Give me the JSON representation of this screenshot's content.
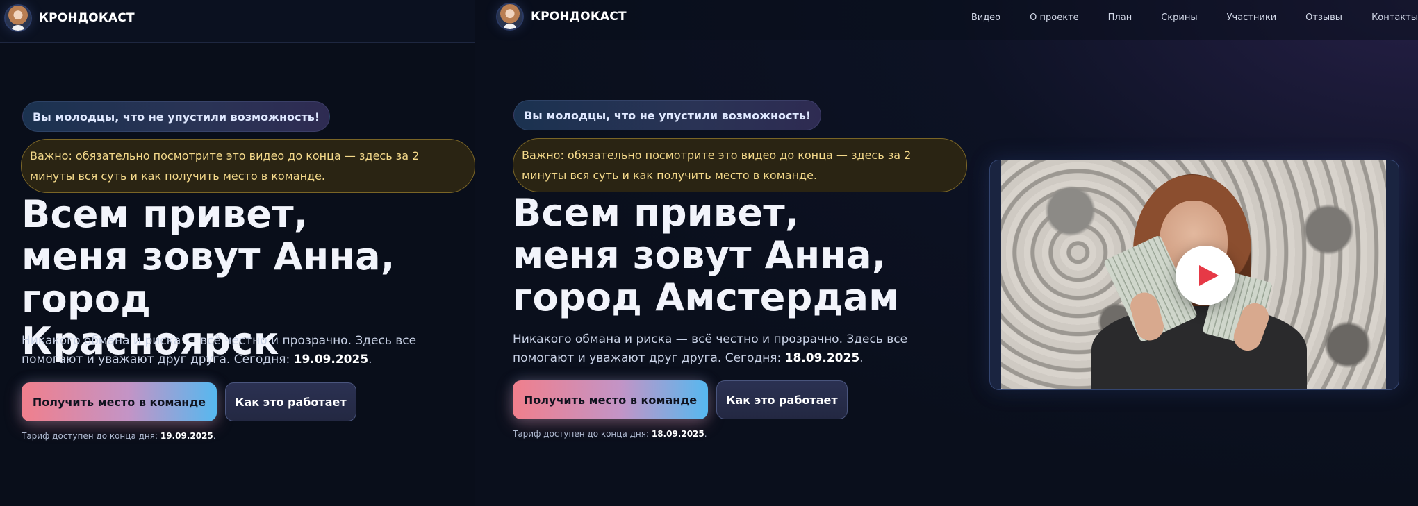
{
  "left": {
    "brand": "КРОНДОКАСТ",
    "pill": "Вы молодцы, что не упустили возможность!",
    "notice": "Важно: обязательно посмотрите это видео до конца — здесь за 2 минуты вся суть и как получить место в команде.",
    "headline": "Всем привет, меня зовут Анна, город Красноярск",
    "lead_text": "Никакого обмана и риска — всё честно и прозрачно. Здесь все помогают и уважают друг друга. Сегодня: ",
    "lead_date": "19.09.2025",
    "lead_end": ".",
    "primary_button": "Получить место в команде",
    "secondary_button": "Как это работает",
    "tariff_text": "Тариф доступен до конца дня: ",
    "tariff_date": "19.09.2025",
    "tariff_end": "."
  },
  "right": {
    "brand": "КРОНДОКАСТ",
    "nav": [
      "Видео",
      "О проекте",
      "План",
      "Скрины",
      "Участники",
      "Отзывы",
      "Контакты"
    ],
    "pill": "Вы молодцы, что не упустили возможность!",
    "notice": "Важно: обязательно посмотрите это видео до конца — здесь за 2 минуты вся суть и как получить место в команде.",
    "headline": "Всем привет, меня зовут Анна, город Амстердам",
    "lead_text": "Никакого обмана и риска — всё честно и прозрачно. Здесь все помогают и уважают друг друга. Сегодня: ",
    "lead_date": "18.09.2025",
    "lead_end": ".",
    "primary_button": "Получить место в команде",
    "secondary_button": "Как это работает",
    "tariff_text": "Тариф доступен до конца дня: ",
    "tariff_date": "18.09.2025",
    "tariff_end": ".",
    "video": {
      "play_icon": "play-icon"
    }
  },
  "colors": {
    "background": "#0a0f1c",
    "notice_text": "#f4d98a",
    "notice_border": "#7a6526",
    "primary_gradient_start": "#f07f8c",
    "primary_gradient_end": "#56b8ef",
    "play_icon": "#e63946"
  }
}
